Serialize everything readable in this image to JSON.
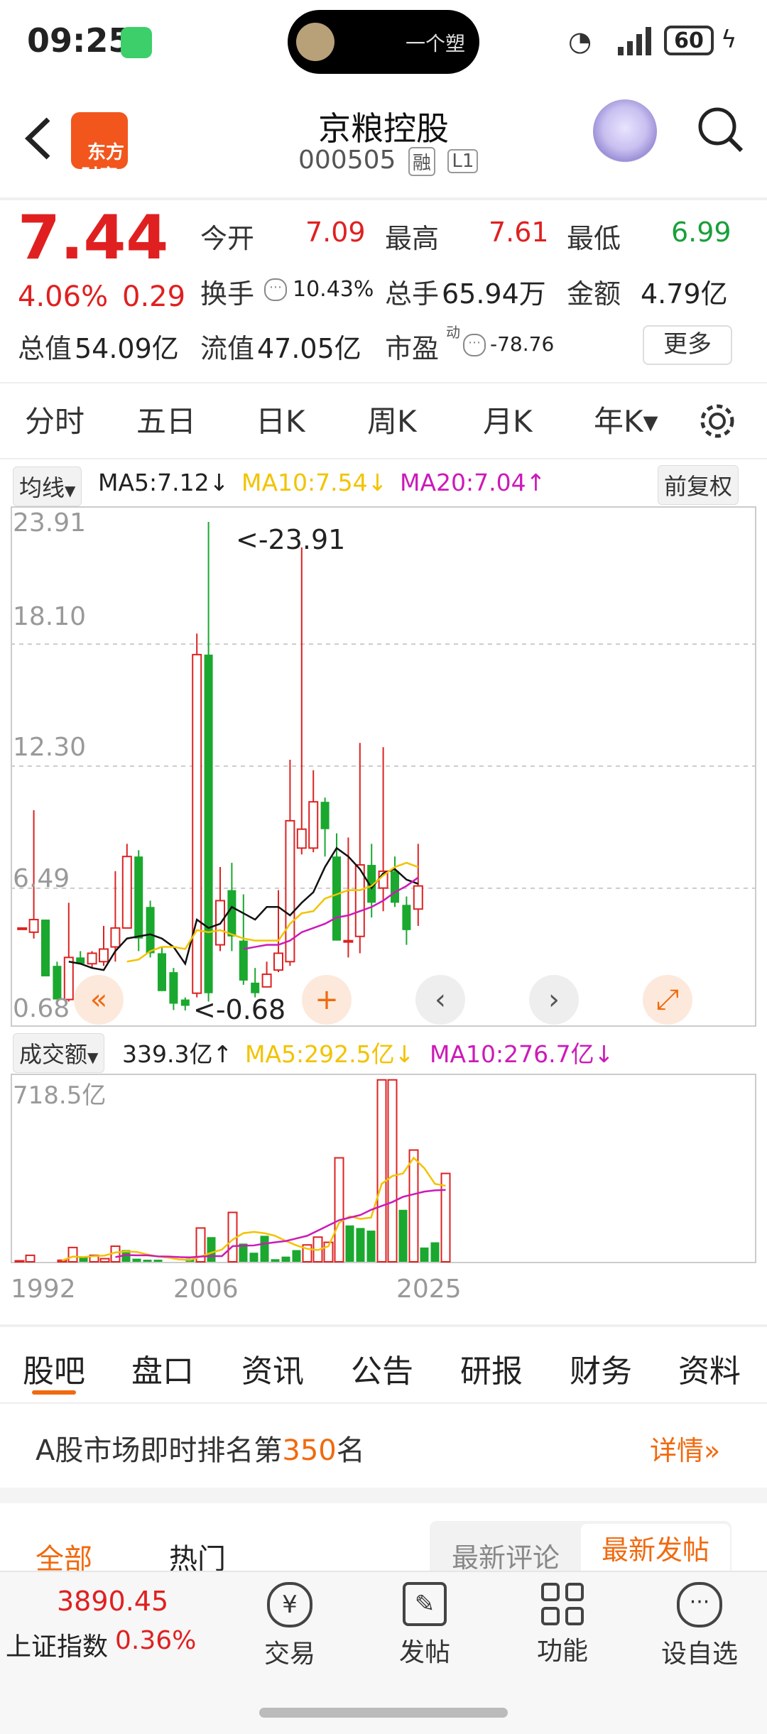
{
  "status": {
    "time": "09:25",
    "island_text": "一个塑",
    "battery": "60"
  },
  "header": {
    "back_icon": "chevron-left-icon",
    "logo_text": "东方\n财富",
    "title": "京粮控股",
    "code": "000505",
    "tags": [
      "融",
      "L1"
    ]
  },
  "quote": {
    "price": "7.44",
    "change_pct": "4.06%",
    "change": "0.29",
    "open_label": "今开",
    "open": "7.09",
    "high_label": "最高",
    "high": "7.61",
    "low_label": "最低",
    "low": "6.99",
    "turnover_label": "换手",
    "turnover": "10.43%",
    "volume_label": "总手",
    "volume": "65.94万",
    "amount_label": "金额",
    "amount": "4.79亿",
    "mktcap_label": "总值",
    "mktcap": "54.09亿",
    "float_label": "流值",
    "float": "47.05亿",
    "pe_label": "市盈",
    "pe_sup": "动",
    "pe": "-78.76",
    "more_label": "更多"
  },
  "period_tabs": [
    "分时",
    "五日",
    "日K",
    "周K",
    "月K",
    "年K▾"
  ],
  "ma_legend": {
    "selector": "均线",
    "ma5": "MA5:7.12↓",
    "ma10": "MA10:7.54↓",
    "ma20": "MA20:7.04↑",
    "adjust": "前复权"
  },
  "price_axis": [
    "23.91",
    "18.10",
    "12.30",
    "6.49",
    "0.68"
  ],
  "annotations": {
    "high": "<-23.91",
    "low": "<-0.68"
  },
  "vol_legend": {
    "selector": "成交额",
    "value": "339.3亿↑",
    "ma5": "MA5:292.5亿↓",
    "ma10": "MA10:276.7亿↓"
  },
  "vol_axis_top": "718.5亿",
  "year_labels": [
    "1992",
    "2006",
    "2025"
  ],
  "chart_data": {
    "type": "candlestick",
    "ylim": [
      0.68,
      23.91
    ],
    "candles": [
      {
        "o": 4.6,
        "c": 4.6,
        "h": 4.6,
        "l": 4.6,
        "up": true
      },
      {
        "o": 4.4,
        "c": 5.0,
        "h": 10.2,
        "l": 4.1,
        "up": true
      },
      {
        "o": 5.0,
        "c": 2.3,
        "h": 5.0,
        "l": 2.3,
        "up": false
      },
      {
        "o": 2.8,
        "c": 1.2,
        "h": 3.0,
        "l": 1.2,
        "up": false
      },
      {
        "o": 1.2,
        "c": 3.2,
        "h": 5.8,
        "l": 1.1,
        "up": true
      },
      {
        "o": 3.2,
        "c": 2.9,
        "h": 3.5,
        "l": 2.9,
        "up": false
      },
      {
        "o": 2.9,
        "c": 3.4,
        "h": 3.5,
        "l": 2.7,
        "up": true
      },
      {
        "o": 3.0,
        "c": 3.6,
        "h": 4.7,
        "l": 2.8,
        "up": true
      },
      {
        "o": 3.7,
        "c": 4.6,
        "h": 7.3,
        "l": 3.0,
        "up": true
      },
      {
        "o": 4.6,
        "c": 8.0,
        "h": 8.6,
        "l": 4.6,
        "up": true
      },
      {
        "o": 8.0,
        "c": 4.1,
        "h": 8.3,
        "l": 3.5,
        "up": false
      },
      {
        "o": 5.6,
        "c": 3.4,
        "h": 5.9,
        "l": 3.2,
        "up": false
      },
      {
        "o": 3.4,
        "c": 1.6,
        "h": 3.7,
        "l": 1.6,
        "up": false
      },
      {
        "o": 2.5,
        "c": 1.0,
        "h": 2.7,
        "l": 0.7,
        "up": false
      },
      {
        "o": 1.2,
        "c": 0.9,
        "h": 1.3,
        "l": 0.68,
        "up": false
      },
      {
        "o": 1.5,
        "c": 17.6,
        "h": 18.6,
        "l": 1.3,
        "up": true
      },
      {
        "o": 17.6,
        "c": 1.5,
        "h": 23.91,
        "l": 1.1,
        "up": false
      },
      {
        "o": 3.8,
        "c": 5.9,
        "h": 7.5,
        "l": 3.5,
        "up": true
      },
      {
        "o": 6.4,
        "c": 4.2,
        "h": 7.7,
        "l": 3.5,
        "up": false
      },
      {
        "o": 4.0,
        "c": 2.1,
        "h": 6.2,
        "l": 1.9,
        "up": false
      },
      {
        "o": 2.0,
        "c": 1.5,
        "h": 2.7,
        "l": 1.3,
        "up": false
      },
      {
        "o": 1.8,
        "c": 2.4,
        "h": 3.0,
        "l": 1.8,
        "up": true
      },
      {
        "o": 2.6,
        "c": 3.4,
        "h": 6.4,
        "l": 2.5,
        "up": true
      },
      {
        "o": 3.0,
        "c": 9.7,
        "h": 12.6,
        "l": 2.8,
        "up": true
      },
      {
        "o": 9.3,
        "c": 8.4,
        "h": 22.7,
        "l": 8.1,
        "up": true
      },
      {
        "o": 8.4,
        "c": 10.6,
        "h": 12.1,
        "l": 8.2,
        "up": true
      },
      {
        "o": 10.6,
        "c": 9.3,
        "h": 10.8,
        "l": 8.0,
        "up": false
      },
      {
        "o": 8.0,
        "c": 4.0,
        "h": 9.1,
        "l": 4.0,
        "up": false
      },
      {
        "o": 4.0,
        "c": 4.0,
        "h": 8.9,
        "l": 3.2,
        "up": true
      },
      {
        "o": 4.2,
        "c": 7.6,
        "h": 13.4,
        "l": 3.4,
        "up": true
      },
      {
        "o": 7.6,
        "c": 5.8,
        "h": 8.6,
        "l": 5.1,
        "up": false
      },
      {
        "o": 6.5,
        "c": 7.3,
        "h": 13.2,
        "l": 5.4,
        "up": true
      },
      {
        "o": 7.3,
        "c": 5.8,
        "h": 8.0,
        "l": 5.6,
        "up": false
      },
      {
        "o": 5.7,
        "c": 4.5,
        "h": 6.1,
        "l": 3.8,
        "up": false
      },
      {
        "o": 5.5,
        "c": 6.6,
        "h": 8.6,
        "l": 4.7,
        "up": true
      }
    ],
    "ma5": [
      null,
      null,
      null,
      null,
      3.0,
      2.9,
      2.7,
      2.6,
      3.5,
      4.1,
      4.2,
      4.3,
      4.1,
      3.7,
      2.9,
      5.0,
      4.6,
      4.8,
      5.6,
      5.3,
      5.0,
      5.6,
      5.6,
      5.2,
      5.8,
      6.3,
      7.5,
      8.4,
      8.0,
      7.4,
      6.5,
      7.2,
      7.4,
      6.9,
      6.7
    ],
    "ma10": [
      null,
      null,
      null,
      null,
      null,
      null,
      null,
      null,
      null,
      3.0,
      3.1,
      3.5,
      3.7,
      3.7,
      3.6,
      4.5,
      4.4,
      4.5,
      4.3,
      4.1,
      4.0,
      4.0,
      4.0,
      4.8,
      5.3,
      5.4,
      6.0,
      6.2,
      6.4,
      6.4,
      6.6,
      7.1,
      7.5,
      7.7,
      7.5
    ],
    "ma20": [
      null,
      null,
      null,
      null,
      null,
      null,
      null,
      null,
      null,
      null,
      null,
      null,
      null,
      null,
      null,
      null,
      null,
      null,
      null,
      3.6,
      3.7,
      3.8,
      3.8,
      4.0,
      4.4,
      4.6,
      4.8,
      5.1,
      5.2,
      5.4,
      5.6,
      5.9,
      6.3,
      6.6,
      7.0
    ],
    "volume_max": 718.5,
    "volume": [
      4,
      25,
      0,
      0,
      6,
      55,
      20,
      25,
      12,
      60,
      45,
      12,
      8,
      8,
      0,
      0,
      12,
      130,
      95,
      0,
      190,
      70,
      35,
      100,
      10,
      20,
      45,
      65,
      95,
      75,
      400,
      140,
      130,
      120,
      700,
      700,
      200,
      430,
      55,
      75,
      340
    ],
    "volume_up": [
      true,
      true,
      false,
      false,
      true,
      true,
      false,
      true,
      true,
      true,
      false,
      false,
      false,
      false,
      false,
      false,
      false,
      true,
      false,
      false,
      true,
      false,
      false,
      false,
      false,
      false,
      false,
      true,
      true,
      true,
      true,
      false,
      false,
      false,
      true,
      true,
      false,
      true,
      false,
      false,
      true
    ],
    "vol_ma5": [
      null,
      null,
      null,
      null,
      5,
      20,
      18,
      22,
      24,
      36,
      40,
      38,
      28,
      20,
      16,
      9,
      7,
      20,
      35,
      47,
      85,
      110,
      115,
      110,
      100,
      80,
      63,
      50,
      45,
      60,
      150,
      175,
      165,
      170,
      300,
      330,
      340,
      400,
      360,
      300,
      292.5
    ],
    "vol_ma10": [
      null,
      null,
      null,
      null,
      null,
      null,
      null,
      null,
      null,
      18,
      26,
      25,
      25,
      21,
      20,
      18,
      17,
      20,
      22,
      22,
      60,
      62,
      63,
      70,
      75,
      80,
      90,
      100,
      120,
      140,
      160,
      170,
      180,
      200,
      215,
      230,
      250,
      260,
      270,
      275,
      276.7
    ]
  },
  "controls": {
    "rewind_icon": "double-chevron-left-icon",
    "add_icon": "plus-icon",
    "prev_icon": "chevron-left-icon",
    "next_icon": "chevron-right-icon",
    "expand_icon": "expand-icon",
    "settings_icon": "gear-icon"
  },
  "info_tabs": [
    "股吧",
    "盘口",
    "资讯",
    "公告",
    "研报",
    "财务",
    "资料"
  ],
  "ranking": {
    "prefix": "A股市场即时排名第",
    "rank": "350",
    "suffix": "名",
    "link": "详情"
  },
  "filter": {
    "all": "全部",
    "hot": "热门",
    "latest_comment": "最新评论",
    "latest_post": "最新发帖"
  },
  "bottom_bar": {
    "index_value": "3890.45",
    "index_name": "上证指数",
    "index_change": "0.36%",
    "trade": "交易",
    "post": "发帖",
    "functions": "功能",
    "watchlist": "设自选"
  }
}
